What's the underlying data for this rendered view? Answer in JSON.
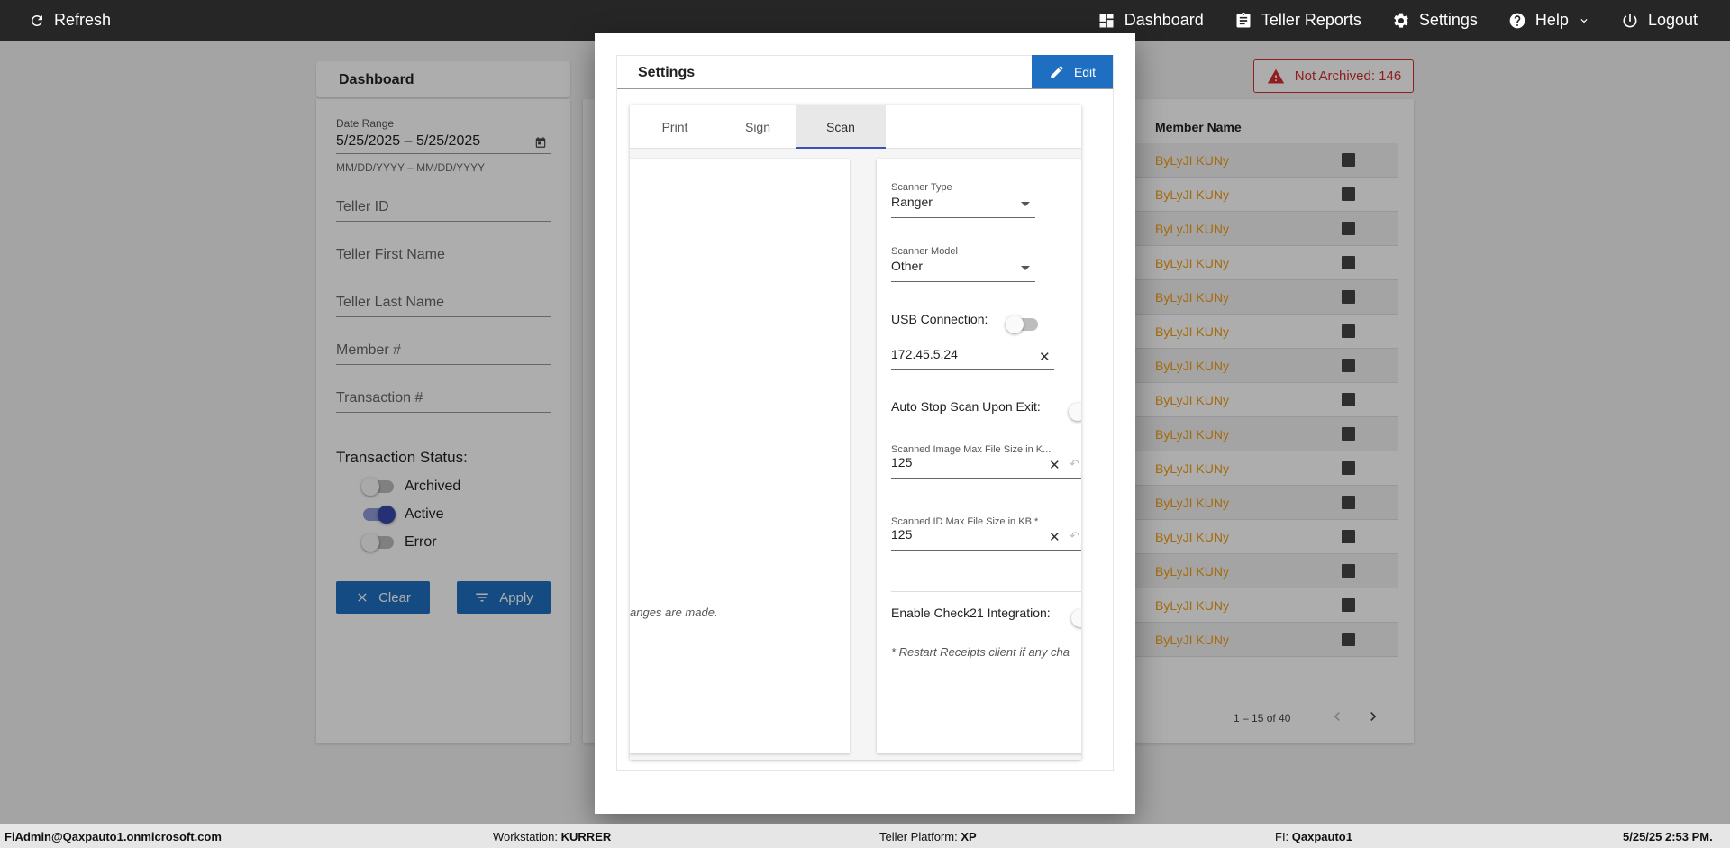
{
  "topbar": {
    "refresh_label": "Refresh",
    "nav": [
      {
        "label": "Dashboard",
        "icon": "dashboard-icon"
      },
      {
        "label": "Teller Reports",
        "icon": "clipboard-icon"
      },
      {
        "label": "Settings",
        "icon": "gear-icon"
      },
      {
        "label": "Help",
        "icon": "help-icon"
      },
      {
        "label": "Logout",
        "icon": "power-icon"
      }
    ]
  },
  "page": {
    "breadcrumb": "Dashboard",
    "filters": {
      "date_range_label": "Date Range",
      "date_range_value": "5/25/2025 – 5/25/2025",
      "date_hint": "MM/DD/YYYY – MM/DD/YYYY",
      "teller_id": "Teller ID",
      "teller_first_name": "Teller First Name",
      "teller_last_name": "Teller Last Name",
      "member_number": "Member #",
      "transaction_number": "Transaction #",
      "status_title": "Transaction Status:",
      "statuses": [
        {
          "label": "Archived",
          "on": false
        },
        {
          "label": "Active",
          "on": true
        },
        {
          "label": "Error",
          "on": false
        }
      ],
      "clear_label": "Clear",
      "apply_label": "Apply"
    },
    "not_archived": "Not Archived: 146",
    "table": {
      "column_member_name": "Member Name",
      "rows": [
        "ByLyJI KUNy",
        "ByLyJI KUNy",
        "ByLyJI KUNy",
        "ByLyJI KUNy",
        "ByLyJI KUNy",
        "ByLyJI KUNy",
        "ByLyJI KUNy",
        "ByLyJI KUNy",
        "ByLyJI KUNy",
        "ByLyJI KUNy",
        "ByLyJI KUNy",
        "ByLyJI KUNy",
        "ByLyJI KUNy",
        "ByLyJI KUNy",
        "ByLyJI KUNy"
      ]
    },
    "pager": "1 – 15 of 40"
  },
  "dialog": {
    "title": "Settings",
    "edit_label": "Edit",
    "tabs": [
      "Print",
      "Sign",
      "Scan"
    ],
    "active_tab": "Scan",
    "left_note": "anges are made.",
    "scan": {
      "scanner_type_label": "Scanner Type",
      "scanner_type_value": "Ranger",
      "scanner_model_label": "Scanner Model",
      "scanner_model_value": "Other",
      "usb_label": "USB Connection:",
      "ip_value": "172.45.5.24",
      "auto_stop_label": "Auto Stop Scan Upon Exit:",
      "max_image_label": "Scanned Image Max File Size in K...",
      "max_image_value": "125",
      "max_id_label": "Scanned ID Max File Size in KB *",
      "max_id_value": "125",
      "check21_label": "Enable Check21 Integration:",
      "restart_note": "* Restart Receipts client if any cha"
    }
  },
  "statusbar": {
    "user": "FiAdmin@Qaxpauto1.onmicrosoft.com",
    "workstation_label": "Workstation:",
    "workstation_value": "KURRER",
    "platform_label": "Teller Platform:",
    "platform_value": "XP",
    "fi_label": "FI:",
    "fi_value": "Qaxpauto1",
    "datetime": "5/25/25 2:53 PM."
  }
}
